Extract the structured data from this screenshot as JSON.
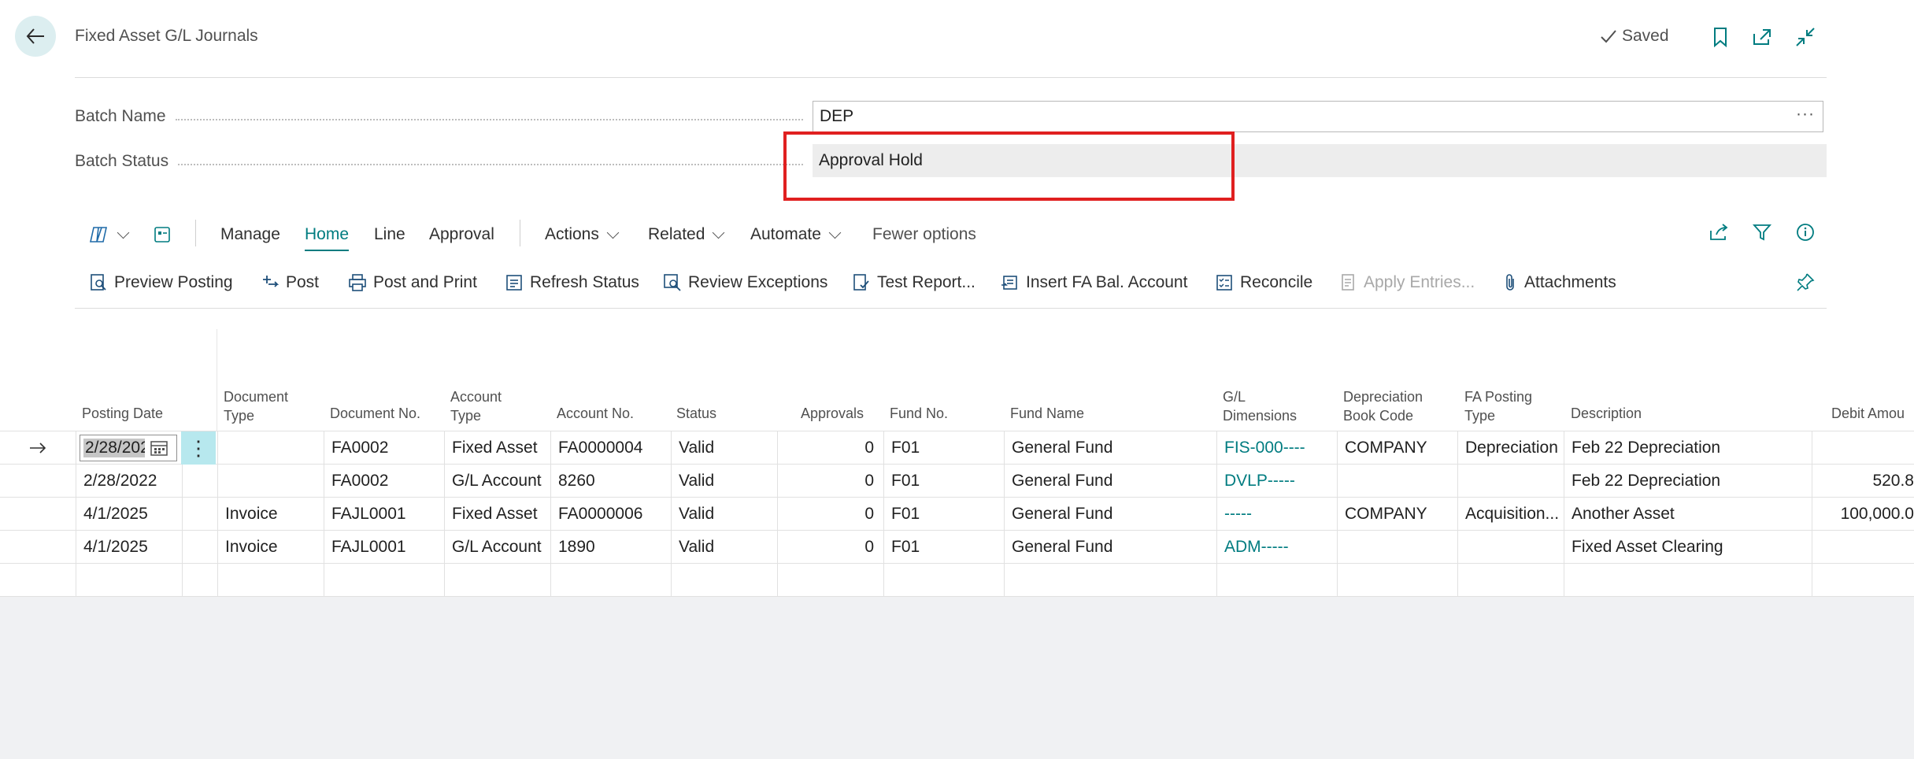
{
  "header": {
    "title": "Fixed Asset G/L Journals",
    "saved_label": "Saved"
  },
  "fields": {
    "batch_name_label": "Batch Name",
    "batch_name_value": "DEP",
    "batch_status_label": "Batch Status",
    "batch_status_value": "Approval Hold"
  },
  "command_bar": {
    "tabs": [
      "Manage",
      "Home",
      "Line",
      "Approval"
    ],
    "menus": [
      "Actions",
      "Related",
      "Automate"
    ],
    "fewer_options": "Fewer options"
  },
  "actions": {
    "preview_posting": "Preview Posting",
    "post": "Post",
    "post_and_print": "Post and Print",
    "refresh_status": "Refresh Status",
    "review_exceptions": "Review Exceptions",
    "test_report": "Test Report...",
    "insert_fa_bal_account": "Insert FA Bal. Account",
    "reconcile": "Reconcile",
    "apply_entries": "Apply Entries...",
    "attachments": "Attachments"
  },
  "columns": {
    "posting_date": "Posting Date",
    "document_type_1": "Document",
    "document_type_2": "Type",
    "document_no": "Document No.",
    "account_type_1": "Account",
    "account_type_2": "Type",
    "account_no": "Account No.",
    "status": "Status",
    "approvals": "Approvals",
    "fund_no": "Fund No.",
    "fund_name": "Fund Name",
    "gl_dimensions_1": "G/L",
    "gl_dimensions_2": "Dimensions",
    "depr_book_1": "Depreciation",
    "depr_book_2": "Book Code",
    "fa_posting_1": "FA Posting",
    "fa_posting_2": "Type",
    "description": "Description",
    "debit_amount": "Debit Amou"
  },
  "rows": [
    {
      "posting_date": "2/28/202",
      "document_type": "",
      "document_no": "FA0002",
      "account_type": "Fixed Asset",
      "account_no": "FA0000004",
      "status": "Valid",
      "approvals": "0",
      "fund_no": "F01",
      "fund_name": "General Fund",
      "gl_dimensions": "FIS-000----",
      "depr_book": "COMPANY",
      "fa_posting_type": "Depreciation",
      "description": "Feb 22 Depreciation",
      "debit_amount": ""
    },
    {
      "posting_date": "2/28/2022",
      "document_type": "",
      "document_no": "FA0002",
      "account_type": "G/L Account",
      "account_no": "8260",
      "status": "Valid",
      "approvals": "0",
      "fund_no": "F01",
      "fund_name": "General Fund",
      "gl_dimensions": "DVLP-----",
      "depr_book": "",
      "fa_posting_type": "",
      "description": "Feb 22 Depreciation",
      "debit_amount": "520.8"
    },
    {
      "posting_date": "4/1/2025",
      "document_type": "Invoice",
      "document_no": "FAJL0001",
      "account_type": "Fixed Asset",
      "account_no": "FA0000006",
      "status": "Valid",
      "approvals": "0",
      "fund_no": "F01",
      "fund_name": "General Fund",
      "gl_dimensions": "-----",
      "depr_book": "COMPANY",
      "fa_posting_type": "Acquisition...",
      "description": "Another Asset",
      "debit_amount": "100,000.0"
    },
    {
      "posting_date": "4/1/2025",
      "document_type": "Invoice",
      "document_no": "FAJL0001",
      "account_type": "G/L Account",
      "account_no": "1890",
      "status": "Valid",
      "approvals": "0",
      "fund_no": "F01",
      "fund_name": "General Fund",
      "gl_dimensions": "ADM-----",
      "depr_book": "",
      "fa_posting_type": "",
      "description": "Fixed Asset Clearing",
      "debit_amount": ""
    }
  ],
  "colors": {
    "accent": "#007c80",
    "highlight_box": "#e02020"
  }
}
